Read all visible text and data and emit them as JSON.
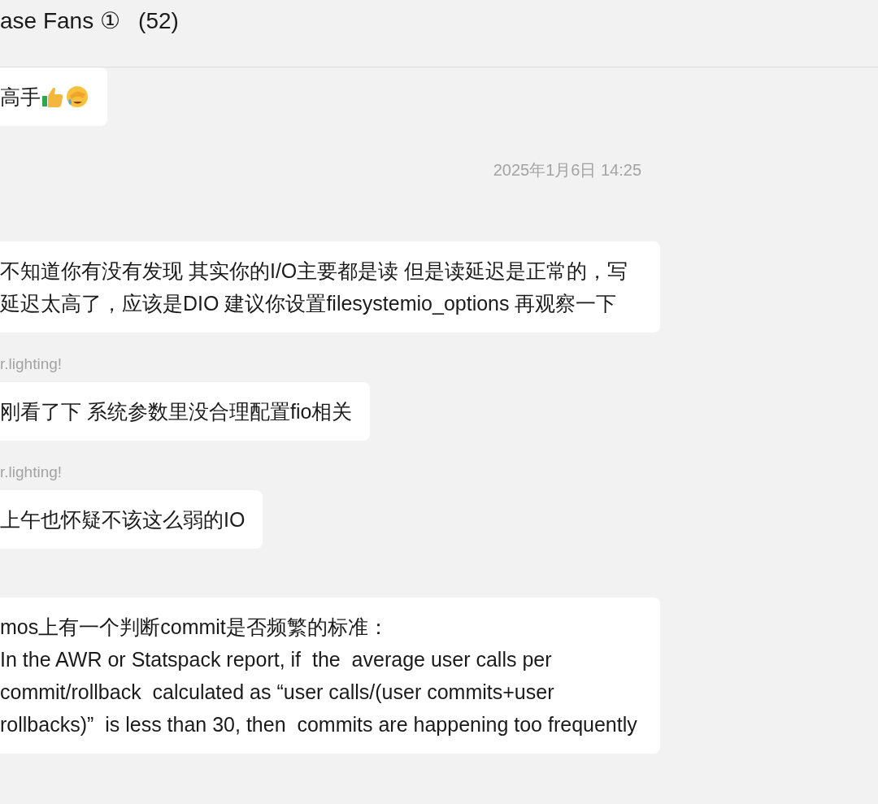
{
  "header": {
    "title": "ase Fans ①",
    "member_count": "(52)"
  },
  "messages": [
    {
      "kind": "emoji_bubble",
      "text": "高手"
    },
    {
      "kind": "time",
      "text": "2025年1月6日 14:25"
    },
    {
      "kind": "bubble",
      "text": "不知道你有没有发现 其实你的I/O主要都是读 但是读延迟是正常的，写延迟太高了，应该是DIO 建议你设置filesystemio_options 再观察一下"
    },
    {
      "kind": "sender",
      "text": "r.lighting!"
    },
    {
      "kind": "bubble",
      "text": "刚看了下 系统参数里没合理配置fio相关"
    },
    {
      "kind": "sender",
      "text": "r.lighting!"
    },
    {
      "kind": "bubble",
      "text": "上午也怀疑不该这么弱的IO"
    },
    {
      "kind": "bubble",
      "text": "mos上有一个判断commit是否频繁的标准：\nIn the AWR or Statspack report, if  the  average user calls per commit/rollback  calculated as “user calls/(user commits+user rollbacks)”  is less than 30, then  commits are happening too frequently"
    }
  ]
}
